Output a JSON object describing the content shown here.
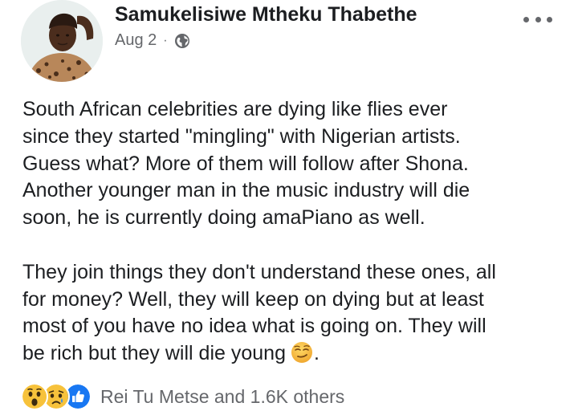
{
  "post": {
    "author_name": "Samukelisiwe Mtheku Thabethe",
    "date": "Aug 2",
    "separator": "·",
    "privacy_icon": "globe-icon",
    "more_icon": "more-options-icon",
    "paragraphs": [
      [
        "South African celebrities are dying like flies ever",
        "since they started \"mingling\" with Nigerian artists.",
        "Guess what? More of them will follow after Shona.",
        "Another younger man in the music industry will die",
        "soon, he is currently doing amaPiano as well."
      ],
      [
        "They join things they don't understand these ones, all",
        "for money? Well, they will keep on dying but at least",
        "most of you have no idea what is going on. They will",
        "be rich but they will die young"
      ]
    ],
    "trailing_emoji": "smirk-emoji",
    "trailing_punctuation": ".",
    "reactions": {
      "icons": [
        "wow-reaction-icon",
        "sad-reaction-icon",
        "like-reaction-icon"
      ],
      "summary": "Rei Tu Metse and 1.6K others"
    }
  },
  "colors": {
    "text_primary": "#1c1e21",
    "text_secondary": "#65676b",
    "reaction_yellow": "#f7c23b",
    "like_blue": "#1877f2"
  }
}
